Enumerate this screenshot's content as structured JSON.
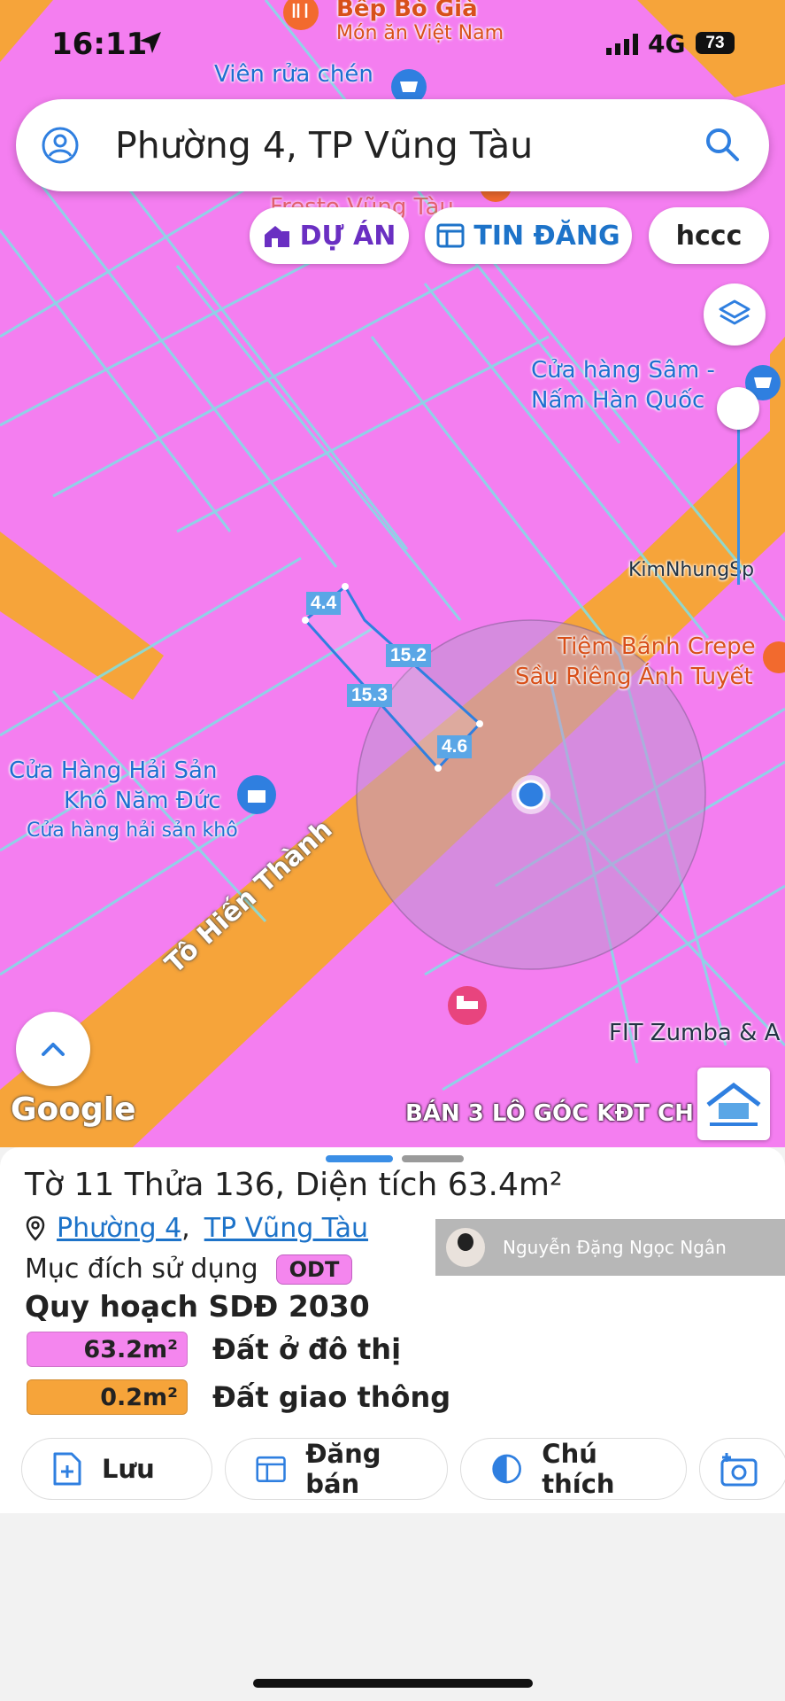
{
  "status_bar": {
    "time": "16:11",
    "network": "4G",
    "battery": "73"
  },
  "search": {
    "text": "Phường 4, TP Vũng Tàu"
  },
  "chips": {
    "project": "DỰ ÁN",
    "listing": "TIN ĐĂNG",
    "custom": "hccc"
  },
  "map": {
    "labels": {
      "bep_bo_gia": "Bếp Bò Già",
      "mon_an": "Món ăn Việt Nam",
      "vien_rua_chen": "Viên rửa chén",
      "fresto": "Fresto Vũng Tàu",
      "sam_1": "Cửa hàng Sâm -",
      "sam_2": "Nấm Hàn Quốc",
      "kimnhung": "KimNhungSp",
      "crepe_1": "Tiệm Bánh Crepe",
      "crepe_2": "Sầu Riêng Ánh Tuyết",
      "haisan_1": "Cửa Hàng Hải Sản",
      "haisan_2": "Khô Năm Đức",
      "haisan_3": "Cửa hàng hải sản khô",
      "fit": "FIT Zumba & A",
      "street": "Tô Hiến Thành",
      "google": "Google",
      "banner": "BÁN 3 LÔ GÓC KĐT CH"
    },
    "dimensions": {
      "top": "4.4",
      "right": "15.2",
      "left": "15.3",
      "bottom": "4.6"
    }
  },
  "parcel": {
    "title": "Tờ 11 Thửa 136, Diện tích 63.4m²",
    "ward": "Phường 4",
    "city": "TP Vũng Tàu",
    "purpose_label": "Mục đích sử dụng",
    "purpose_code": "ODT",
    "plan_title": "Quy hoạch SDĐ 2030",
    "zones": [
      {
        "area": "63.2m²",
        "label": "Đất ở đô thị",
        "color": "#f486ee"
      },
      {
        "area": "0.2m²",
        "label": "Đất giao thông",
        "color": "#f6a43a"
      }
    ]
  },
  "actions": {
    "save": "Lưu",
    "post": "Đăng bán",
    "legend": "Chú thích"
  },
  "watermark": {
    "name": "Nguyễn Đặng Ngọc Ngân"
  },
  "colors": {
    "map_pink": "#f47ef0",
    "road_orange": "#f6a43a",
    "accent_blue": "#1d73c9",
    "project_purple": "#6a2fc2"
  }
}
